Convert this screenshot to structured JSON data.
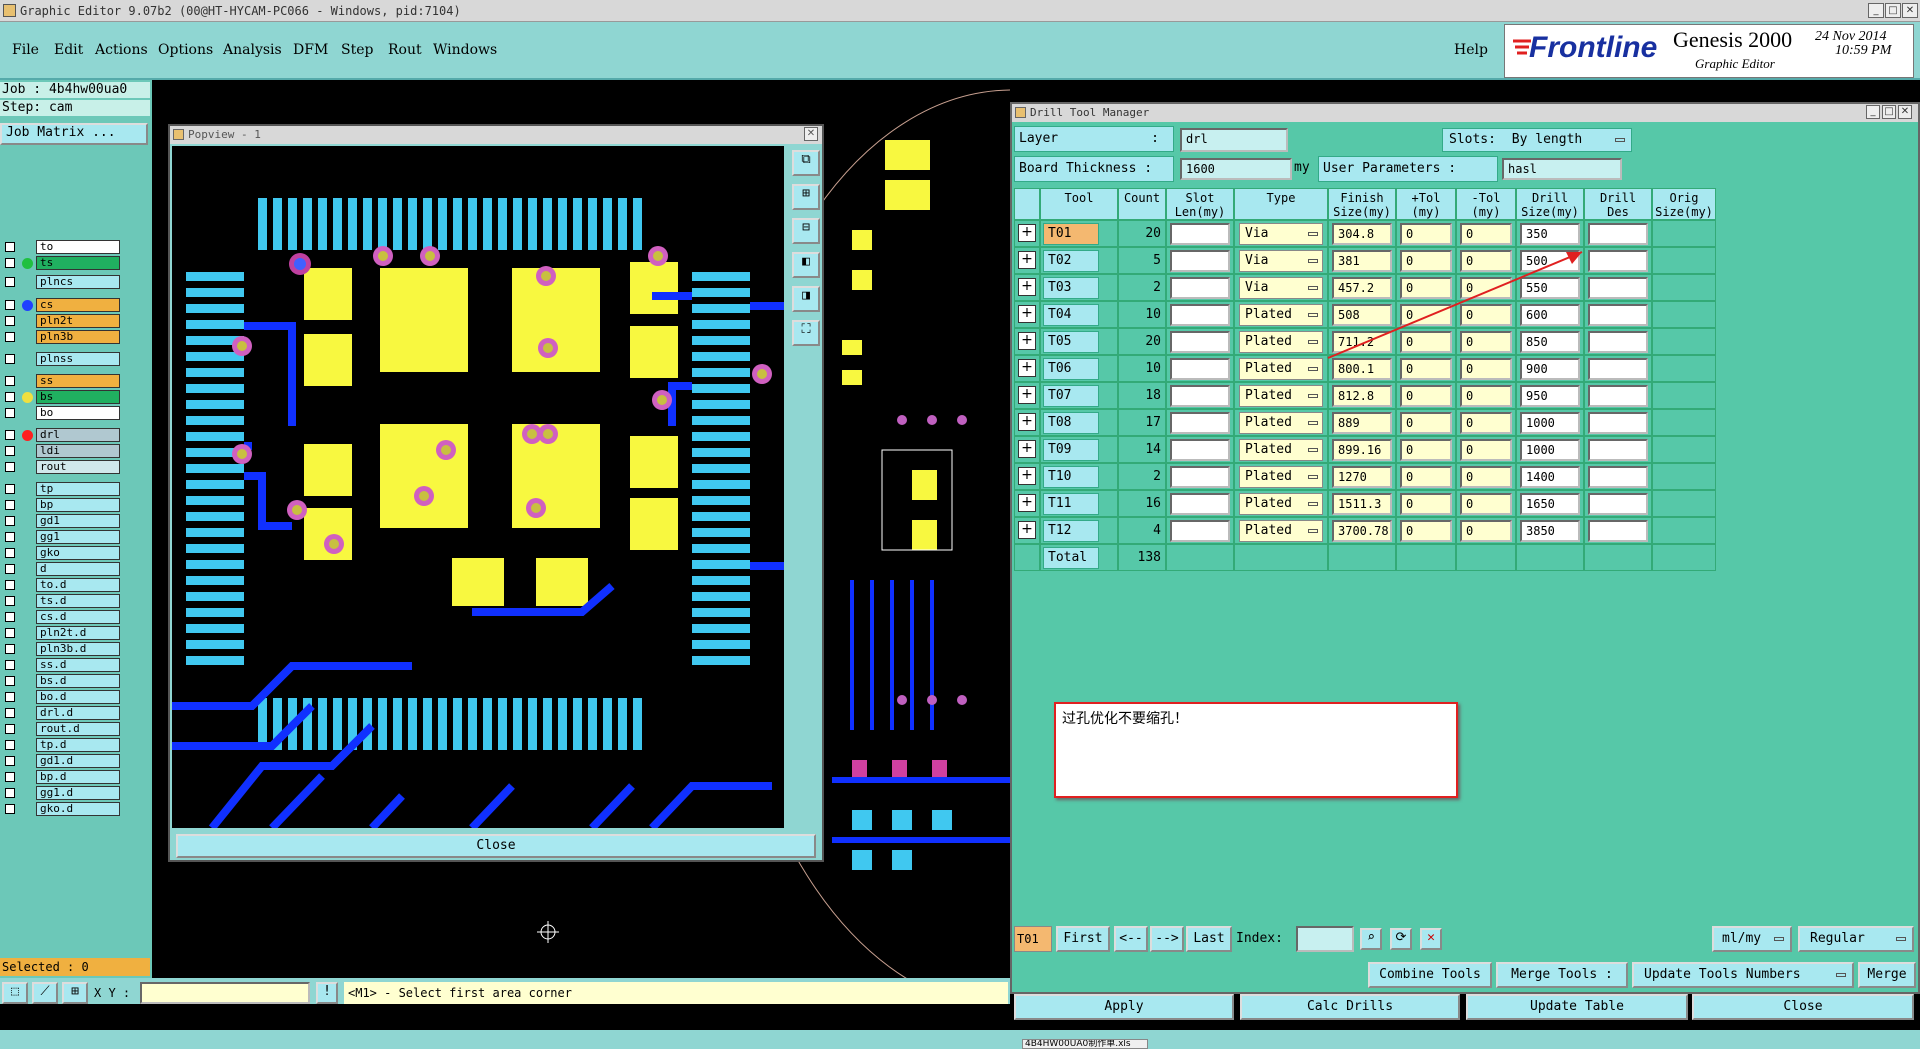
{
  "window_title": "Graphic Editor 9.07b2 (00@HT-HYCAM-PC066 - Windows, pid:7104)",
  "menu": [
    "File",
    "Edit",
    "Actions",
    "Options",
    "Analysis",
    "DFM",
    "Step",
    "Rout",
    "Windows"
  ],
  "help": "Help",
  "brand": {
    "logo": "Frontline",
    "product": "Genesis 2000",
    "subtitle": "Graphic Editor",
    "date": "24 Nov 2014",
    "time": "10:59 PM"
  },
  "job": {
    "job": "Job : 4b4hw00ua0",
    "step": "Step: cam",
    "matrix_btn": "Job Matrix ..."
  },
  "layers": [
    {
      "name": "to",
      "color": "#ffffff"
    },
    {
      "name": "ts",
      "color": "#20b060",
      "dot": "#20c040"
    },
    {
      "name": "plncs",
      "color": "#a8e8f0"
    },
    {
      "name": "cs",
      "color": "#f0b040",
      "dot": "#2040ff"
    },
    {
      "name": "pln2t",
      "color": "#f0b040"
    },
    {
      "name": "pln3b",
      "color": "#f0b040"
    },
    {
      "name": "plnss",
      "color": "#a8e8f0"
    },
    {
      "name": "ss",
      "color": "#f0b040"
    },
    {
      "name": "bs",
      "color": "#20b060",
      "dot": "#f0e040"
    },
    {
      "name": "bo",
      "color": "#ffffff"
    },
    {
      "name": "drl",
      "color": "#b0c8d0",
      "dot": "#ff2020"
    },
    {
      "name": "ldi",
      "color": "#b0c8d0"
    },
    {
      "name": "rout",
      "color": "#d0e8ec"
    },
    {
      "name": "tp",
      "color": "#a8e8f0"
    },
    {
      "name": "bp",
      "color": "#a8e8f0"
    },
    {
      "name": "gd1",
      "color": "#a8e8f0"
    },
    {
      "name": "gg1",
      "color": "#a8e8f0"
    },
    {
      "name": "gko",
      "color": "#a8e8f0"
    },
    {
      "name": "d",
      "color": "#a8e8f0"
    },
    {
      "name": "to.d",
      "color": "#a8e8f0"
    },
    {
      "name": "ts.d",
      "color": "#a8e8f0"
    },
    {
      "name": "cs.d",
      "color": "#a8e8f0"
    },
    {
      "name": "pln2t.d",
      "color": "#a8e8f0"
    },
    {
      "name": "pln3b.d",
      "color": "#a8e8f0"
    },
    {
      "name": "ss.d",
      "color": "#a8e8f0"
    },
    {
      "name": "bs.d",
      "color": "#a8e8f0"
    },
    {
      "name": "bo.d",
      "color": "#a8e8f0"
    },
    {
      "name": "drl.d",
      "color": "#a8e8f0"
    },
    {
      "name": "rout.d",
      "color": "#a8e8f0"
    },
    {
      "name": "tp.d",
      "color": "#a8e8f0"
    },
    {
      "name": "gd1.d",
      "color": "#a8e8f0"
    },
    {
      "name": "bp.d",
      "color": "#a8e8f0"
    },
    {
      "name": "gg1.d",
      "color": "#a8e8f0"
    },
    {
      "name": "gko.d",
      "color": "#a8e8f0"
    }
  ],
  "selected": "Selected : 0",
  "status": {
    "xy_label": "X Y :",
    "message": "<M1> - Select first area corner"
  },
  "popview": {
    "title": "Popview - 1",
    "close": "Close"
  },
  "dtm": {
    "title": "Drill Tool Manager",
    "layer_label": "Layer",
    "layer_value": "drl",
    "slots_label": "Slots:",
    "slots_value": "By length",
    "board_label": "Board Thickness :",
    "board_value": "1600",
    "board_unit": "my",
    "user_params_label": "User Parameters :",
    "user_params_value": "hasl",
    "headers": [
      "Tool",
      "Count",
      "Slot Len(my)",
      "Type",
      "Finish Size(my)",
      "+Tol (my)",
      "-Tol (my)",
      "Drill Size(my)",
      "Drill Des",
      "Orig Size(my)"
    ],
    "rows": [
      {
        "tool": "T01",
        "count": "20",
        "type": "Via",
        "finish": "304.8",
        "ptol": "0",
        "mtol": "0",
        "drill": "350"
      },
      {
        "tool": "T02",
        "count": "5",
        "type": "Via",
        "finish": "381",
        "ptol": "0",
        "mtol": "0",
        "drill": "500"
      },
      {
        "tool": "T03",
        "count": "2",
        "type": "Via",
        "finish": "457.2",
        "ptol": "0",
        "mtol": "0",
        "drill": "550"
      },
      {
        "tool": "T04",
        "count": "10",
        "type": "Plated",
        "finish": "508",
        "ptol": "0",
        "mtol": "0",
        "drill": "600"
      },
      {
        "tool": "T05",
        "count": "20",
        "type": "Plated",
        "finish": "711.2",
        "ptol": "0",
        "mtol": "0",
        "drill": "850"
      },
      {
        "tool": "T06",
        "count": "10",
        "type": "Plated",
        "finish": "800.1",
        "ptol": "0",
        "mtol": "0",
        "drill": "900"
      },
      {
        "tool": "T07",
        "count": "18",
        "type": "Plated",
        "finish": "812.8",
        "ptol": "0",
        "mtol": "0",
        "drill": "950"
      },
      {
        "tool": "T08",
        "count": "17",
        "type": "Plated",
        "finish": "889",
        "ptol": "0",
        "mtol": "0",
        "drill": "1000"
      },
      {
        "tool": "T09",
        "count": "14",
        "type": "Plated",
        "finish": "899.16",
        "ptol": "0",
        "mtol": "0",
        "drill": "1000"
      },
      {
        "tool": "T10",
        "count": "2",
        "type": "Plated",
        "finish": "1270",
        "ptol": "0",
        "mtol": "0",
        "drill": "1400"
      },
      {
        "tool": "T11",
        "count": "16",
        "type": "Plated",
        "finish": "1511.3",
        "ptol": "0",
        "mtol": "0",
        "drill": "1650"
      },
      {
        "tool": "T12",
        "count": "4",
        "type": "Plated",
        "finish": "3700.78",
        "ptol": "0",
        "mtol": "0",
        "drill": "3850"
      }
    ],
    "total_label": "Total",
    "total_value": "138",
    "note": "过孔优化不要缩孔！",
    "nav": {
      "current": "T01",
      "first": "First",
      "prev": "<--",
      "next": "-->",
      "last": "Last",
      "index": "Index:",
      "units": "ml/my",
      "mode": "Regular"
    },
    "actions": {
      "combine": "Combine Tools",
      "merge_label": "Merge Tools :",
      "update_numbers": "Update Tools Numbers",
      "merge": "Merge"
    },
    "bottom": {
      "apply": "Apply",
      "calc": "Calc Drills",
      "update": "Update Table",
      "close": "Close"
    }
  },
  "taskbar_item": "4B4HW00UA0制作单.xls"
}
